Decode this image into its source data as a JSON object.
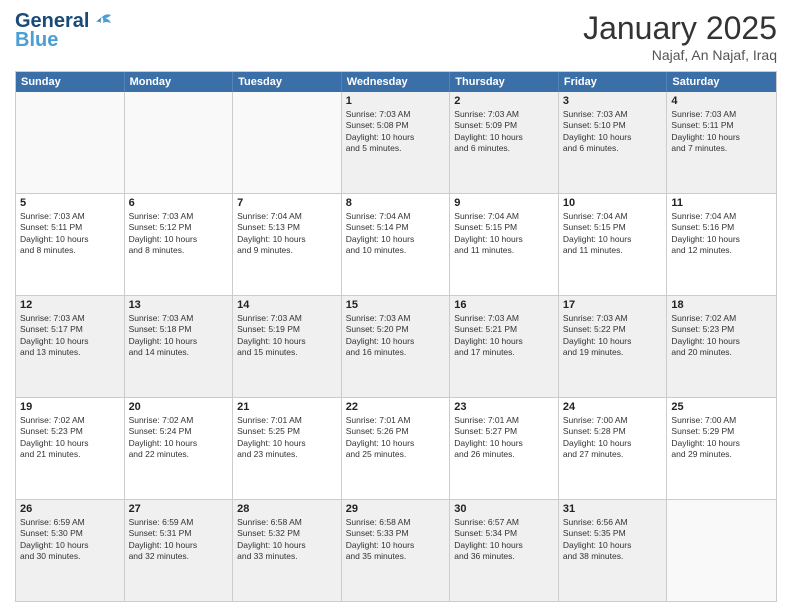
{
  "logo": {
    "general": "General",
    "blue": "Blue"
  },
  "title": "January 2025",
  "location": "Najaf, An Najaf, Iraq",
  "days": [
    "Sunday",
    "Monday",
    "Tuesday",
    "Wednesday",
    "Thursday",
    "Friday",
    "Saturday"
  ],
  "weeks": [
    [
      {
        "day": "",
        "empty": true
      },
      {
        "day": "",
        "empty": true
      },
      {
        "day": "",
        "empty": true
      },
      {
        "day": "1",
        "lines": [
          "Sunrise: 7:03 AM",
          "Sunset: 5:08 PM",
          "Daylight: 10 hours",
          "and 5 minutes."
        ]
      },
      {
        "day": "2",
        "lines": [
          "Sunrise: 7:03 AM",
          "Sunset: 5:09 PM",
          "Daylight: 10 hours",
          "and 6 minutes."
        ]
      },
      {
        "day": "3",
        "lines": [
          "Sunrise: 7:03 AM",
          "Sunset: 5:10 PM",
          "Daylight: 10 hours",
          "and 6 minutes."
        ]
      },
      {
        "day": "4",
        "lines": [
          "Sunrise: 7:03 AM",
          "Sunset: 5:11 PM",
          "Daylight: 10 hours",
          "and 7 minutes."
        ]
      }
    ],
    [
      {
        "day": "5",
        "lines": [
          "Sunrise: 7:03 AM",
          "Sunset: 5:11 PM",
          "Daylight: 10 hours",
          "and 8 minutes."
        ]
      },
      {
        "day": "6",
        "lines": [
          "Sunrise: 7:03 AM",
          "Sunset: 5:12 PM",
          "Daylight: 10 hours",
          "and 8 minutes."
        ]
      },
      {
        "day": "7",
        "lines": [
          "Sunrise: 7:04 AM",
          "Sunset: 5:13 PM",
          "Daylight: 10 hours",
          "and 9 minutes."
        ]
      },
      {
        "day": "8",
        "lines": [
          "Sunrise: 7:04 AM",
          "Sunset: 5:14 PM",
          "Daylight: 10 hours",
          "and 10 minutes."
        ]
      },
      {
        "day": "9",
        "lines": [
          "Sunrise: 7:04 AM",
          "Sunset: 5:15 PM",
          "Daylight: 10 hours",
          "and 11 minutes."
        ]
      },
      {
        "day": "10",
        "lines": [
          "Sunrise: 7:04 AM",
          "Sunset: 5:15 PM",
          "Daylight: 10 hours",
          "and 11 minutes."
        ]
      },
      {
        "day": "11",
        "lines": [
          "Sunrise: 7:04 AM",
          "Sunset: 5:16 PM",
          "Daylight: 10 hours",
          "and 12 minutes."
        ]
      }
    ],
    [
      {
        "day": "12",
        "lines": [
          "Sunrise: 7:03 AM",
          "Sunset: 5:17 PM",
          "Daylight: 10 hours",
          "and 13 minutes."
        ]
      },
      {
        "day": "13",
        "lines": [
          "Sunrise: 7:03 AM",
          "Sunset: 5:18 PM",
          "Daylight: 10 hours",
          "and 14 minutes."
        ]
      },
      {
        "day": "14",
        "lines": [
          "Sunrise: 7:03 AM",
          "Sunset: 5:19 PM",
          "Daylight: 10 hours",
          "and 15 minutes."
        ]
      },
      {
        "day": "15",
        "lines": [
          "Sunrise: 7:03 AM",
          "Sunset: 5:20 PM",
          "Daylight: 10 hours",
          "and 16 minutes."
        ]
      },
      {
        "day": "16",
        "lines": [
          "Sunrise: 7:03 AM",
          "Sunset: 5:21 PM",
          "Daylight: 10 hours",
          "and 17 minutes."
        ]
      },
      {
        "day": "17",
        "lines": [
          "Sunrise: 7:03 AM",
          "Sunset: 5:22 PM",
          "Daylight: 10 hours",
          "and 19 minutes."
        ]
      },
      {
        "day": "18",
        "lines": [
          "Sunrise: 7:02 AM",
          "Sunset: 5:23 PM",
          "Daylight: 10 hours",
          "and 20 minutes."
        ]
      }
    ],
    [
      {
        "day": "19",
        "lines": [
          "Sunrise: 7:02 AM",
          "Sunset: 5:23 PM",
          "Daylight: 10 hours",
          "and 21 minutes."
        ]
      },
      {
        "day": "20",
        "lines": [
          "Sunrise: 7:02 AM",
          "Sunset: 5:24 PM",
          "Daylight: 10 hours",
          "and 22 minutes."
        ]
      },
      {
        "day": "21",
        "lines": [
          "Sunrise: 7:01 AM",
          "Sunset: 5:25 PM",
          "Daylight: 10 hours",
          "and 23 minutes."
        ]
      },
      {
        "day": "22",
        "lines": [
          "Sunrise: 7:01 AM",
          "Sunset: 5:26 PM",
          "Daylight: 10 hours",
          "and 25 minutes."
        ]
      },
      {
        "day": "23",
        "lines": [
          "Sunrise: 7:01 AM",
          "Sunset: 5:27 PM",
          "Daylight: 10 hours",
          "and 26 minutes."
        ]
      },
      {
        "day": "24",
        "lines": [
          "Sunrise: 7:00 AM",
          "Sunset: 5:28 PM",
          "Daylight: 10 hours",
          "and 27 minutes."
        ]
      },
      {
        "day": "25",
        "lines": [
          "Sunrise: 7:00 AM",
          "Sunset: 5:29 PM",
          "Daylight: 10 hours",
          "and 29 minutes."
        ]
      }
    ],
    [
      {
        "day": "26",
        "lines": [
          "Sunrise: 6:59 AM",
          "Sunset: 5:30 PM",
          "Daylight: 10 hours",
          "and 30 minutes."
        ]
      },
      {
        "day": "27",
        "lines": [
          "Sunrise: 6:59 AM",
          "Sunset: 5:31 PM",
          "Daylight: 10 hours",
          "and 32 minutes."
        ]
      },
      {
        "day": "28",
        "lines": [
          "Sunrise: 6:58 AM",
          "Sunset: 5:32 PM",
          "Daylight: 10 hours",
          "and 33 minutes."
        ]
      },
      {
        "day": "29",
        "lines": [
          "Sunrise: 6:58 AM",
          "Sunset: 5:33 PM",
          "Daylight: 10 hours",
          "and 35 minutes."
        ]
      },
      {
        "day": "30",
        "lines": [
          "Sunrise: 6:57 AM",
          "Sunset: 5:34 PM",
          "Daylight: 10 hours",
          "and 36 minutes."
        ]
      },
      {
        "day": "31",
        "lines": [
          "Sunrise: 6:56 AM",
          "Sunset: 5:35 PM",
          "Daylight: 10 hours",
          "and 38 minutes."
        ]
      },
      {
        "day": "",
        "empty": true
      }
    ]
  ]
}
